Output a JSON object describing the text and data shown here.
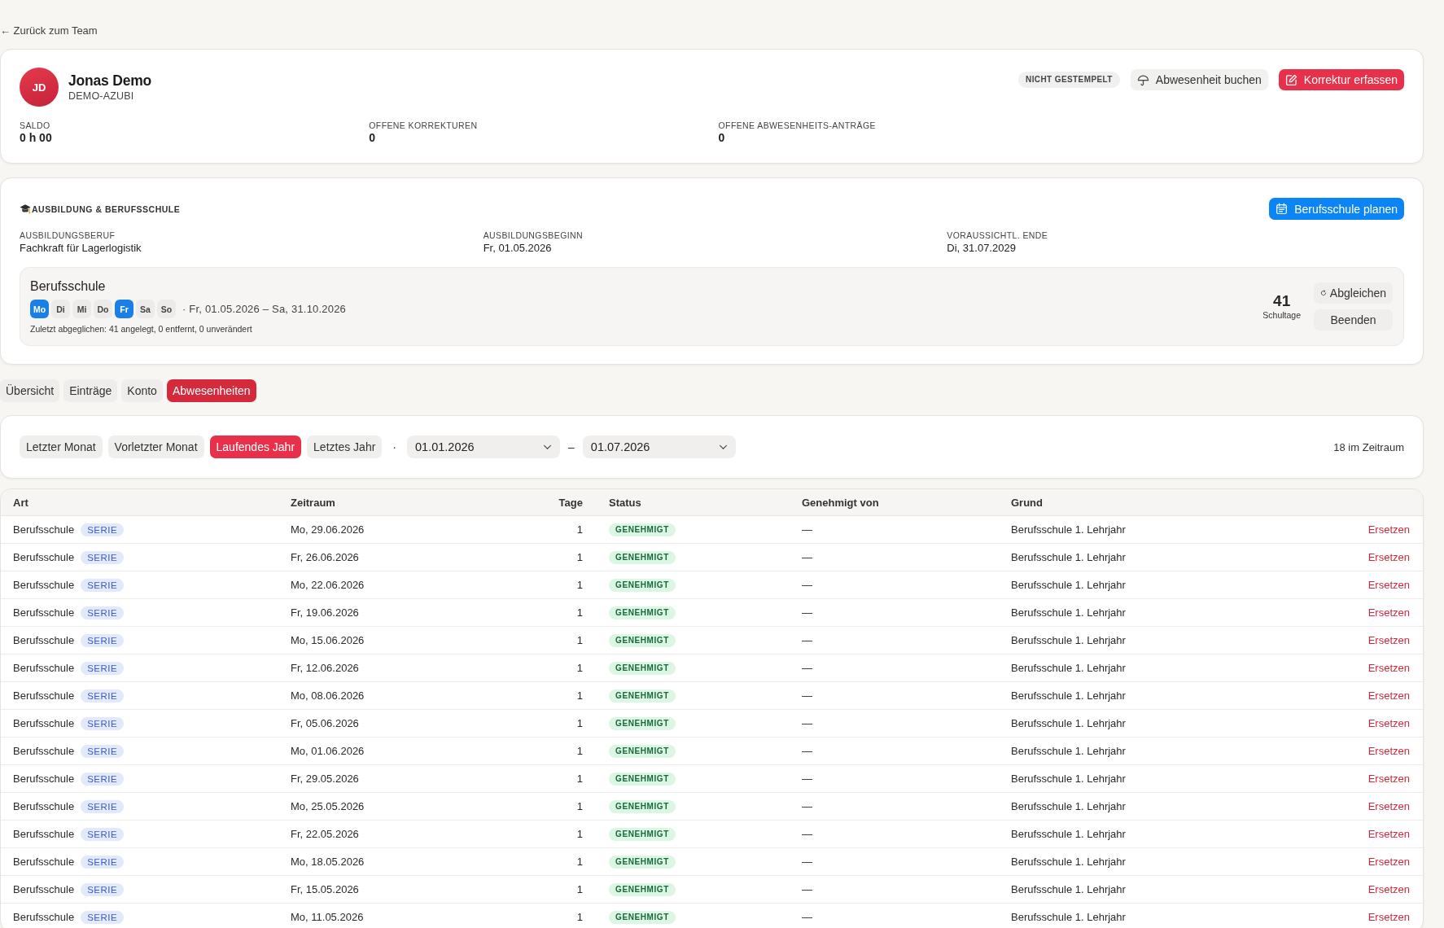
{
  "back_link": "← Zurück zum Team",
  "profile": {
    "initials": "JD",
    "name": "Jonas Demo",
    "role": "DEMO-AZUBI",
    "status_badge": "NICHT GESTEMPELT",
    "actions": [
      {
        "label": "Abwesenheit buchen",
        "kind": "absence"
      },
      {
        "label": "Korrektur erfassen",
        "kind": "correction"
      }
    ],
    "stats": [
      {
        "label": "SALDO",
        "value": "0 h 00"
      },
      {
        "label": "OFFENE KORREKTUREN",
        "value": "0"
      },
      {
        "label": "OFFENE ABWESENHEITS-ANTRÄGE",
        "value": "0"
      }
    ]
  },
  "training": {
    "title": "AUSBILDUNG & BERUFSSCHULE",
    "plan_button": "Berufsschule planen",
    "fields": [
      {
        "label": "AUSBILDUNGSBERUF",
        "value": "Fachkraft für Lagerlogistik"
      },
      {
        "label": "AUSBILDUNGSBEGINN",
        "value": "Fr, 01.05.2026"
      },
      {
        "label": "VORAUSSICHTL. ENDE",
        "value": "Di, 31.07.2029"
      }
    ],
    "school": {
      "title": "Berufsschule",
      "days": [
        {
          "label": "Mo",
          "selected": true
        },
        {
          "label": "Di",
          "selected": false
        },
        {
          "label": "Mi",
          "selected": false
        },
        {
          "label": "Do",
          "selected": false
        },
        {
          "label": "Fr",
          "selected": true
        },
        {
          "label": "Sa",
          "selected": false
        },
        {
          "label": "So",
          "selected": false
        }
      ],
      "period": "· Fr, 01.05.2026 – Sa, 31.10.2026",
      "sync_note": "Zuletzt abgeglichen: 41 angelegt, 0 entfernt, 0 unverändert",
      "count": "41",
      "count_label": "Schultage",
      "actions": [
        {
          "label": "Abgleichen",
          "kind": "sync"
        },
        {
          "label": "Beenden",
          "kind": "end"
        }
      ]
    }
  },
  "tabs": [
    {
      "label": "Übersicht",
      "selected": false
    },
    {
      "label": "Einträge",
      "selected": false
    },
    {
      "label": "Konto",
      "selected": false
    },
    {
      "label": "Abwesenheiten",
      "selected": true
    }
  ],
  "filter": {
    "presets": [
      {
        "label": "Letzter Monat",
        "selected": false
      },
      {
        "label": "Vorletzter Monat",
        "selected": false
      },
      {
        "label": "Laufendes Jahr",
        "selected": true
      },
      {
        "label": "Letztes Jahr",
        "selected": false
      }
    ],
    "separator": "·",
    "date_from": "01.01.2026",
    "range_dash": "–",
    "date_to": "01.07.2026",
    "result_count": "18 im Zeitraum"
  },
  "table": {
    "columns": [
      "Art",
      "Zeitraum",
      "Tage",
      "Status",
      "Genehmigt von",
      "Grund"
    ],
    "rows": [
      {
        "art": "Berufsschule",
        "tag": "SERIE",
        "zeitraum": "Mo, 29.06.2026",
        "tage": "1",
        "status": "GENEHMIGT",
        "genehmigt_von": "—",
        "grund": "Berufsschule 1. Lehrjahr",
        "action": "Ersetzen"
      },
      {
        "art": "Berufsschule",
        "tag": "SERIE",
        "zeitraum": "Fr, 26.06.2026",
        "tage": "1",
        "status": "GENEHMIGT",
        "genehmigt_von": "—",
        "grund": "Berufsschule 1. Lehrjahr",
        "action": "Ersetzen"
      },
      {
        "art": "Berufsschule",
        "tag": "SERIE",
        "zeitraum": "Mo, 22.06.2026",
        "tage": "1",
        "status": "GENEHMIGT",
        "genehmigt_von": "—",
        "grund": "Berufsschule 1. Lehrjahr",
        "action": "Ersetzen"
      },
      {
        "art": "Berufsschule",
        "tag": "SERIE",
        "zeitraum": "Fr, 19.06.2026",
        "tage": "1",
        "status": "GENEHMIGT",
        "genehmigt_von": "—",
        "grund": "Berufsschule 1. Lehrjahr",
        "action": "Ersetzen"
      },
      {
        "art": "Berufsschule",
        "tag": "SERIE",
        "zeitraum": "Mo, 15.06.2026",
        "tage": "1",
        "status": "GENEHMIGT",
        "genehmigt_von": "—",
        "grund": "Berufsschule 1. Lehrjahr",
        "action": "Ersetzen"
      },
      {
        "art": "Berufsschule",
        "tag": "SERIE",
        "zeitraum": "Fr, 12.06.2026",
        "tage": "1",
        "status": "GENEHMIGT",
        "genehmigt_von": "—",
        "grund": "Berufsschule 1. Lehrjahr",
        "action": "Ersetzen"
      },
      {
        "art": "Berufsschule",
        "tag": "SERIE",
        "zeitraum": "Mo, 08.06.2026",
        "tage": "1",
        "status": "GENEHMIGT",
        "genehmigt_von": "—",
        "grund": "Berufsschule 1. Lehrjahr",
        "action": "Ersetzen"
      },
      {
        "art": "Berufsschule",
        "tag": "SERIE",
        "zeitraum": "Fr, 05.06.2026",
        "tage": "1",
        "status": "GENEHMIGT",
        "genehmigt_von": "—",
        "grund": "Berufsschule 1. Lehrjahr",
        "action": "Ersetzen"
      },
      {
        "art": "Berufsschule",
        "tag": "SERIE",
        "zeitraum": "Mo, 01.06.2026",
        "tage": "1",
        "status": "GENEHMIGT",
        "genehmigt_von": "—",
        "grund": "Berufsschule 1. Lehrjahr",
        "action": "Ersetzen"
      },
      {
        "art": "Berufsschule",
        "tag": "SERIE",
        "zeitraum": "Fr, 29.05.2026",
        "tage": "1",
        "status": "GENEHMIGT",
        "genehmigt_von": "—",
        "grund": "Berufsschule 1. Lehrjahr",
        "action": "Ersetzen"
      },
      {
        "art": "Berufsschule",
        "tag": "SERIE",
        "zeitraum": "Mo, 25.05.2026",
        "tage": "1",
        "status": "GENEHMIGT",
        "genehmigt_von": "—",
        "grund": "Berufsschule 1. Lehrjahr",
        "action": "Ersetzen"
      },
      {
        "art": "Berufsschule",
        "tag": "SERIE",
        "zeitraum": "Fr, 22.05.2026",
        "tage": "1",
        "status": "GENEHMIGT",
        "genehmigt_von": "—",
        "grund": "Berufsschule 1. Lehrjahr",
        "action": "Ersetzen"
      },
      {
        "art": "Berufsschule",
        "tag": "SERIE",
        "zeitraum": "Mo, 18.05.2026",
        "tage": "1",
        "status": "GENEHMIGT",
        "genehmigt_von": "—",
        "grund": "Berufsschule 1. Lehrjahr",
        "action": "Ersetzen"
      },
      {
        "art": "Berufsschule",
        "tag": "SERIE",
        "zeitraum": "Fr, 15.05.2026",
        "tage": "1",
        "status": "GENEHMIGT",
        "genehmigt_von": "—",
        "grund": "Berufsschule 1. Lehrjahr",
        "action": "Ersetzen"
      },
      {
        "art": "Berufsschule",
        "tag": "SERIE",
        "zeitraum": "Mo, 11.05.2026",
        "tage": "1",
        "status": "GENEHMIGT",
        "genehmigt_von": "—",
        "grund": "Berufsschule 1. Lehrjahr",
        "action": "Ersetzen"
      }
    ]
  }
}
